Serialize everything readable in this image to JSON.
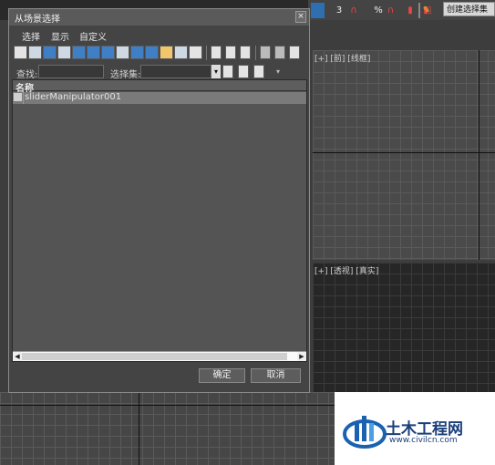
{
  "dialog": {
    "title": "从场景选择",
    "close": "×",
    "menu": [
      "选择",
      "显示",
      "自定义"
    ],
    "find_label": "查找:",
    "selset_label": "选择集:",
    "column_name": "名称",
    "rows": [
      {
        "name": "sliderManipulator001"
      }
    ],
    "ok": "确定",
    "cancel": "取消"
  },
  "toolbar_right": {
    "counter": "3",
    "percent": "%",
    "sel_set": "创建选择集"
  },
  "viewports": {
    "front": "[+] [前] [线框]",
    "perspective": "[+] [透视] [真实]"
  },
  "logo": {
    "text": "土木工程网",
    "url": "www.civilcn.com"
  }
}
